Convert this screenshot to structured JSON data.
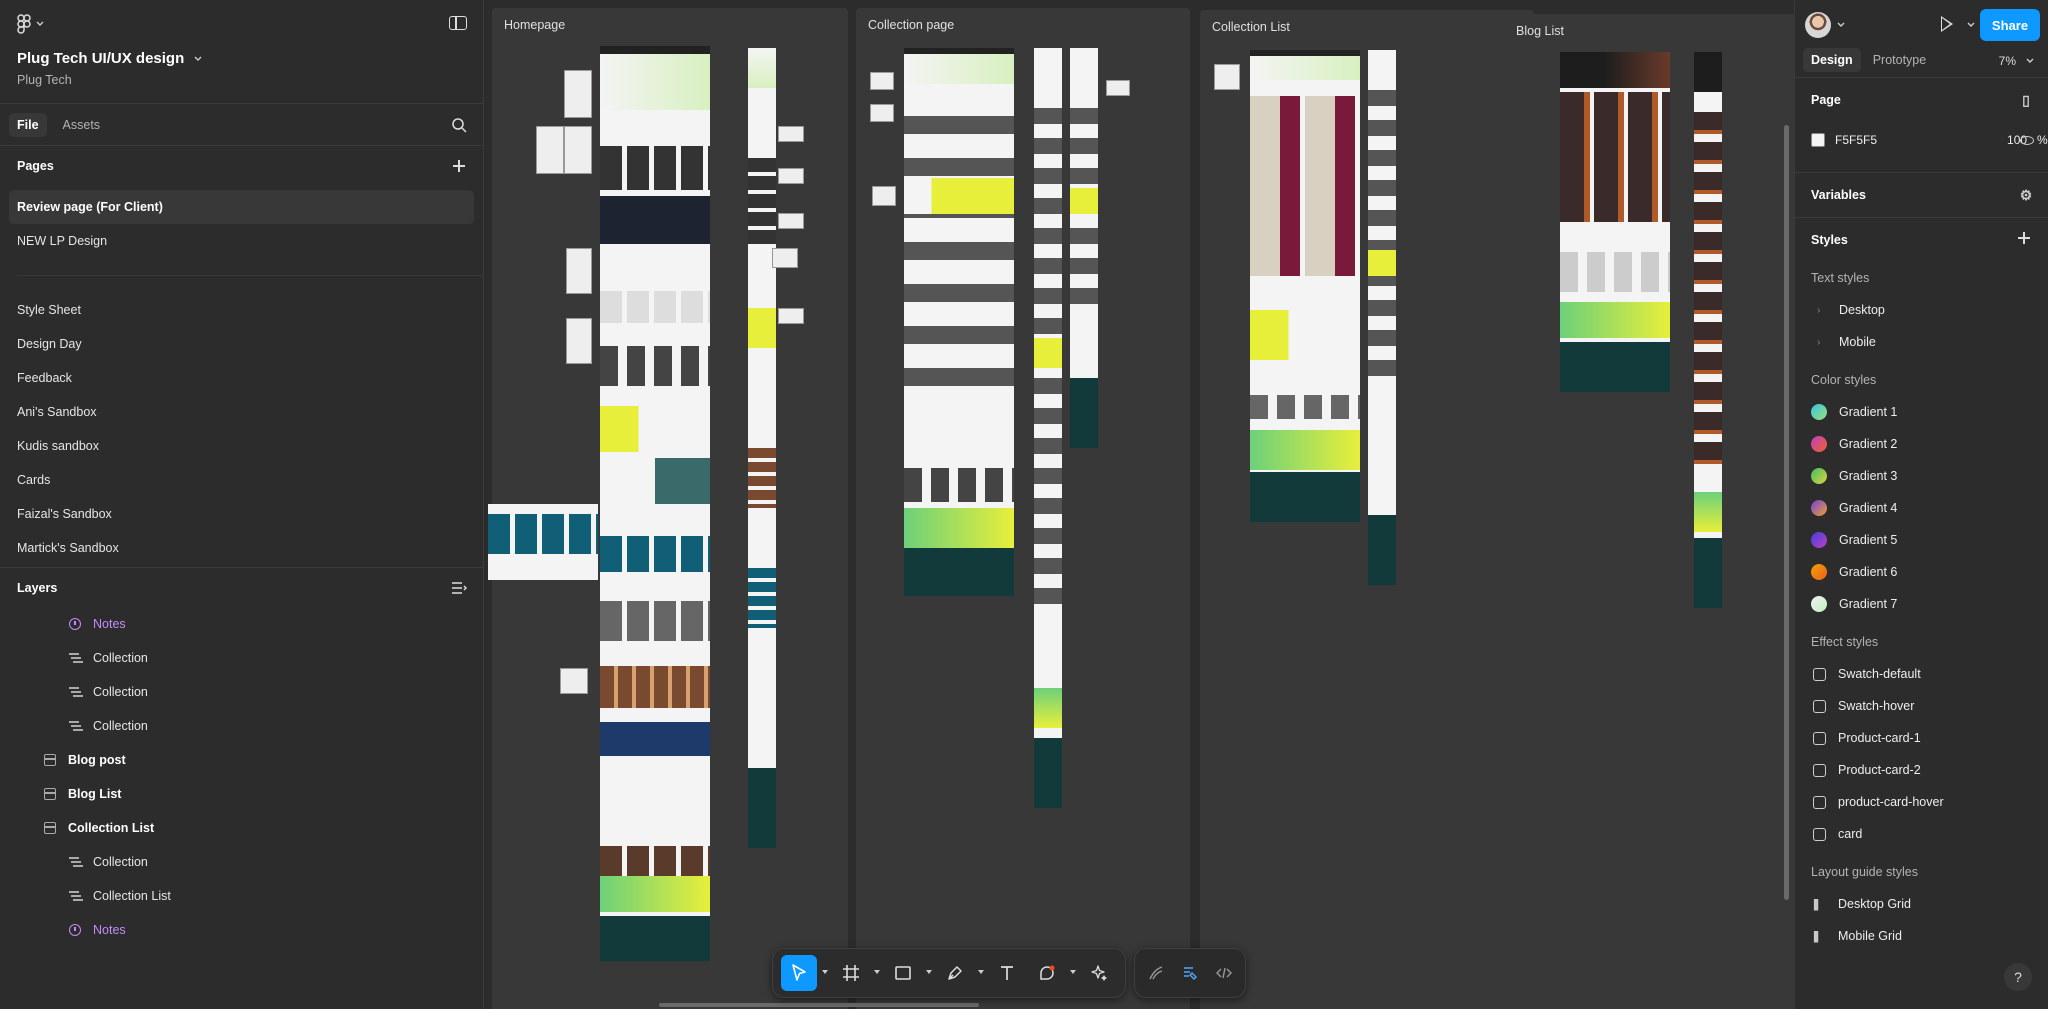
{
  "left_panel": {
    "file_title": "Plug Tech UI/UX design",
    "team_name": "Plug Tech",
    "tabs": [
      "File",
      "Assets"
    ],
    "pages_heading": "Pages",
    "pages_primary": [
      "Review page (For Client)",
      "NEW LP Design"
    ],
    "pages_secondary": [
      "Style Sheet",
      "Design Day",
      "Feedback",
      "Ani's Sandbox",
      "Kudis sandbox",
      "Cards",
      "Faizal's Sandbox",
      "Martick's Sandbox"
    ],
    "layers_heading": "Layers",
    "layers": [
      {
        "label": "Notes",
        "type": "note"
      },
      {
        "label": "Collection",
        "type": "child"
      },
      {
        "label": "Collection",
        "type": "child"
      },
      {
        "label": "Collection",
        "type": "child"
      },
      {
        "label": "Blog post",
        "type": "section"
      },
      {
        "label": "Blog List",
        "type": "section"
      },
      {
        "label": "Collection List",
        "type": "section"
      },
      {
        "label": "Collection",
        "type": "child"
      },
      {
        "label": "Collection List",
        "type": "child"
      },
      {
        "label": "Notes",
        "type": "note"
      }
    ]
  },
  "canvas": {
    "sections": [
      "Homepage",
      "Collection page",
      "Collection List",
      "Blog List"
    ]
  },
  "right_panel": {
    "share_label": "Share",
    "tabs": [
      "Design",
      "Prototype"
    ],
    "zoom": "7%",
    "page_heading": "Page",
    "bg_color": "F5F5F5",
    "bg_opacity": "100",
    "bg_opacity_unit": "%",
    "variables_heading": "Variables",
    "styles_heading": "Styles",
    "text_styles_heading": "Text styles",
    "text_styles": [
      "Desktop",
      "Mobile"
    ],
    "color_styles_heading": "Color styles",
    "color_styles": [
      {
        "name": "Gradient 1",
        "from": "#37c5e0",
        "to": "#9ae07a"
      },
      {
        "name": "Gradient 2",
        "from": "#c040c0",
        "to": "#f06030"
      },
      {
        "name": "Gradient 3",
        "from": "#40c060",
        "to": "#e0d040"
      },
      {
        "name": "Gradient 4",
        "from": "#7040e0",
        "to": "#f0a030"
      },
      {
        "name": "Gradient 5",
        "from": "#4040e0",
        "to": "#c040c0"
      },
      {
        "name": "Gradient 6",
        "from": "#f0a000",
        "to": "#f06020"
      },
      {
        "name": "Gradient 7",
        "from": "#f0f0f0",
        "to": "#c0f0c0"
      }
    ],
    "effect_styles_heading": "Effect styles",
    "effect_styles": [
      "Swatch-default",
      "Swatch-hover",
      "Product-card-1",
      "Product-card-2",
      "product-card-hover",
      "card"
    ],
    "layout_guide_heading": "Layout guide styles",
    "layout_guides": [
      "Desktop Grid",
      "Mobile Grid"
    ],
    "help_label": "?"
  }
}
